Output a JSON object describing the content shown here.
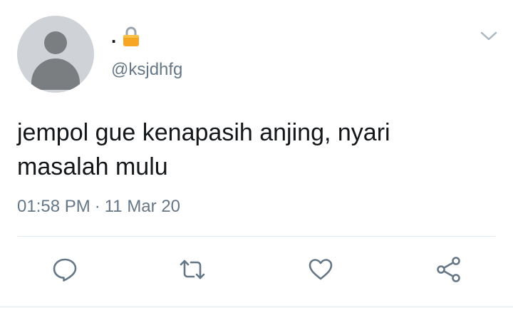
{
  "tweet": {
    "display_name": ".",
    "handle": "@ksjdhfg",
    "text": "jempol gue kenapasih anjing, nyari masalah mulu",
    "time": "01:58 PM",
    "separator": "·",
    "date": "11 Mar 20"
  },
  "icons": {
    "protected": "lock-icon",
    "menu": "chevron-down-icon",
    "reply": "reply-icon",
    "retweet": "retweet-icon",
    "like": "heart-icon",
    "share": "share-icon"
  },
  "colors": {
    "text_primary": "#14171a",
    "text_secondary": "#657786",
    "icon": "#657786",
    "lock": "#f6a623",
    "avatar_bg": "#cfd3d7",
    "avatar_fg": "#7b7e81",
    "divider": "#e1e8ed"
  }
}
